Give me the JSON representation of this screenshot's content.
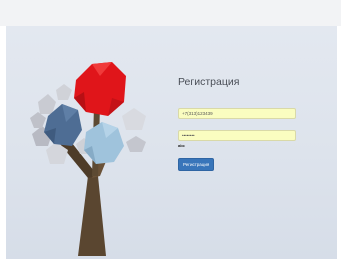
{
  "register": {
    "title": "Регистрация",
    "phone_value": "+7(313)123439",
    "password_value": "••••••••",
    "link_label": "abc",
    "submit_label": "Регистрация"
  },
  "colors": {
    "submit": "#3875ba",
    "field_autofill": "#fafdc0",
    "background": "#e3e8f0"
  },
  "illustration": {
    "name": "low-poly-tree"
  }
}
